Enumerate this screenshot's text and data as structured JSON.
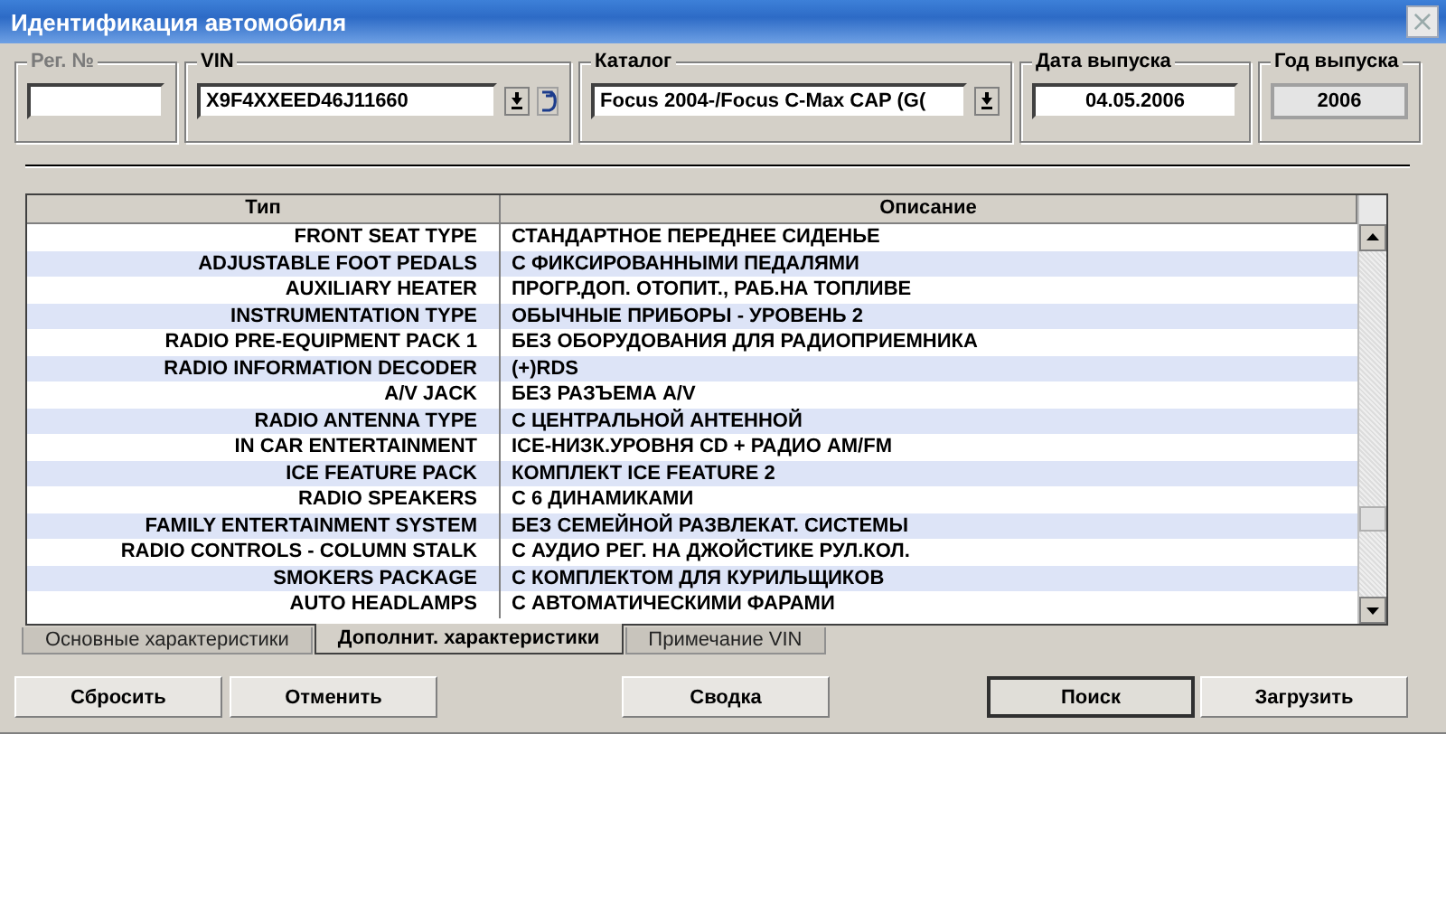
{
  "window": {
    "title": "Идентификация автомобиля",
    "close": "×"
  },
  "fields": [
    {
      "label": "Рег. №",
      "kind": "plain",
      "disabled": true
    },
    {
      "label": "VIN",
      "value": "X9F4XXEED46J11660",
      "kind": "combo_reset",
      "disabled": false
    },
    {
      "label": "Каталог",
      "value": "Focus 2004-/Focus C-Max CAP (G(",
      "kind": "combo",
      "disabled": false
    },
    {
      "label": "Дата выпуска",
      "value": "04.05.2006",
      "kind": "centered",
      "disabled": false
    },
    {
      "label": "Год выпуска",
      "value": "2006",
      "kind": "readonly",
      "disabled": false
    }
  ],
  "table": {
    "columns": [
      "Тип",
      "Описание"
    ],
    "rows": [
      [
        "FRONT SEAT TYPE",
        "СТАНДАРТНОЕ ПЕРЕДНЕЕ СИДЕНЬЕ"
      ],
      [
        "ADJUSTABLE FOOT PEDALS",
        "С ФИКСИРОВАННЫМИ ПЕДАЛЯМИ"
      ],
      [
        "AUXILIARY HEATER",
        "ПРОГР.ДОП. ОТОПИТ., РАБ.НА ТОПЛИВЕ"
      ],
      [
        "INSTRUMENTATION TYPE",
        "ОБЫЧНЫЕ ПРИБОРЫ - УРОВЕНЬ 2"
      ],
      [
        "RADIO PRE-EQUIPMENT PACK 1",
        "БЕЗ ОБОРУДОВАНИЯ ДЛЯ РАДИОПРИЕМНИКА"
      ],
      [
        "RADIO INFORMATION DECODER",
        "(+)RDS"
      ],
      [
        "A/V JACK",
        "БЕЗ РАЗЪЕМА A/V"
      ],
      [
        "RADIO ANTENNA TYPE",
        "С ЦЕНТРАЛЬНОЙ АНТЕННОЙ"
      ],
      [
        "IN CAR ENTERTAINMENT",
        "ICE-НИЗК.УРОВНЯ CD + РАДИО AM/FM"
      ],
      [
        "ICE FEATURE PACK",
        "КОМПЛЕКТ ICE FEATURE 2"
      ],
      [
        "RADIO SPEAKERS",
        "С 6 ДИНАМИКАМИ"
      ],
      [
        "FAMILY ENTERTAINMENT SYSTEM",
        "БЕЗ СЕМЕЙНОЙ РАЗВЛЕКАТ. СИСТЕМЫ"
      ],
      [
        "RADIO CONTROLS - COLUMN STALK",
        "С АУДИО РЕГ. НА ДЖОЙСТИКЕ РУЛ.КОЛ."
      ],
      [
        "SMOKERS PACKAGE",
        "С КОМПЛЕКТОМ ДЛЯ КУРИЛЬЩИКОВ"
      ],
      [
        "AUTO HEADLAMPS",
        "С АВТОМАТИЧЕСКИМИ ФАРАМИ"
      ]
    ]
  },
  "tabs": [
    {
      "label": "Основные характеристики",
      "selected": false
    },
    {
      "label": "Дополнит. характеристики",
      "selected": true
    },
    {
      "label": "Примечание VIN",
      "selected": false
    }
  ],
  "buttons": [
    {
      "label": "Сбросить",
      "default": false
    },
    {
      "label": "Отменить",
      "default": false
    },
    {
      "label": "Сводка",
      "default": false
    },
    {
      "label": "Поиск",
      "default": true
    },
    {
      "label": "Загрузить",
      "default": false
    }
  ]
}
